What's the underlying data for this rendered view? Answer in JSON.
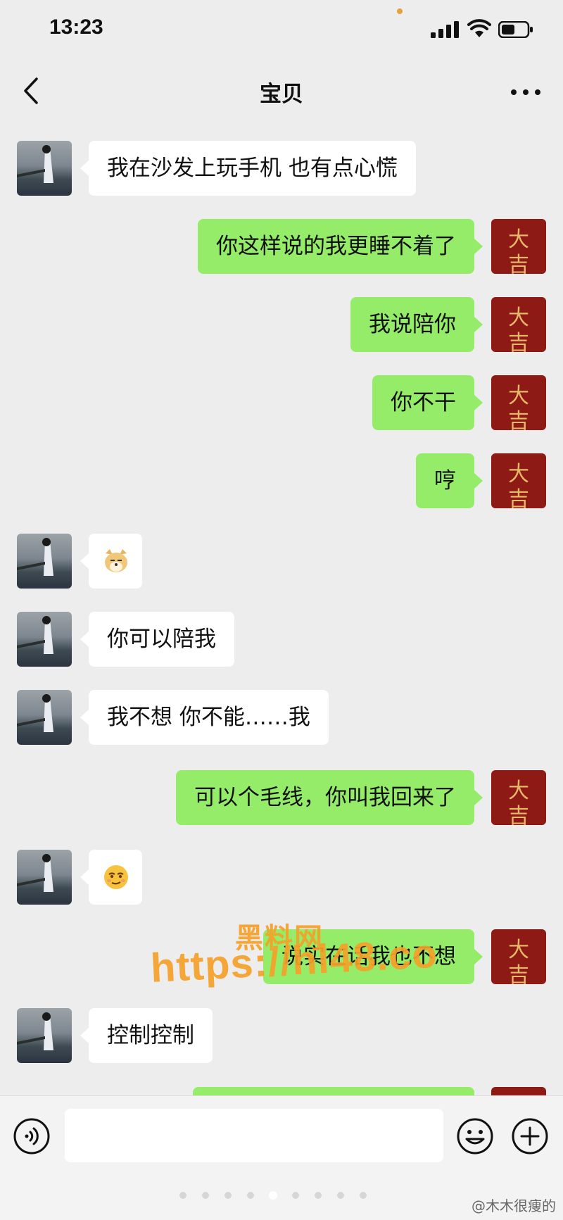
{
  "status_bar": {
    "time": "13:23"
  },
  "header": {
    "title": "宝贝"
  },
  "messages": [
    {
      "side": "in",
      "text": "我在沙发上玩手机 也有点心慌"
    },
    {
      "side": "out",
      "text": "你这样说的我更睡不着了"
    },
    {
      "side": "out",
      "text": "我说陪你"
    },
    {
      "side": "out",
      "text": "你不干"
    },
    {
      "side": "out",
      "text": "哼"
    },
    {
      "side": "in",
      "emoji": "doge-emoji"
    },
    {
      "side": "in",
      "text": "你可以陪我"
    },
    {
      "side": "in",
      "text": "我不想 你不能……我"
    },
    {
      "side": "out",
      "text": "可以个毛线，你叫我回来了"
    },
    {
      "side": "in",
      "emoji": "smirk-emoji"
    },
    {
      "side": "out",
      "text": "说实在话我也不想"
    },
    {
      "side": "in",
      "text": "控制控制"
    }
  ],
  "my_avatar": {
    "top": "大",
    "bottom": "吉"
  },
  "watermark": {
    "line1": "黑料网",
    "line2": "https://hl48.co"
  },
  "footer_credit": "@木木很痩的",
  "colors": {
    "incoming_bubble": "#ffffff",
    "outgoing_bubble": "#95ec69",
    "avatar_red": "#8e1a15",
    "watermark": "#f5a12a"
  }
}
